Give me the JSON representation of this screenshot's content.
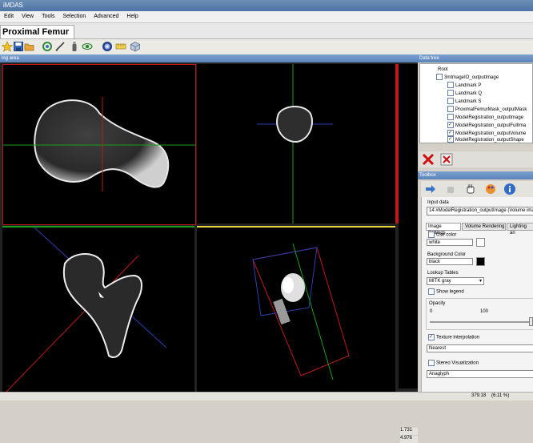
{
  "window": {
    "title": "iMDAS"
  },
  "menu": [
    "Edit",
    "View",
    "Tools",
    "Selection",
    "Advanced",
    "Help"
  ],
  "project_tab": "Proximal Femur",
  "toolbar_icons": [
    "star-icon",
    "save-icon",
    "open-folder-icon",
    "recycle-icon",
    "pen-icon",
    "bottle-icon",
    "eye-icon",
    "target-icon",
    "ruler-icon",
    "cube-icon"
  ],
  "viewer": {
    "title": "ing area",
    "scale_labels": [
      "1.731",
      "4.976"
    ]
  },
  "data_tree": {
    "title": "Data tree",
    "root": "Root",
    "items": [
      {
        "label": "3mImageIO_outputImage",
        "checked": false
      },
      {
        "label": "Landmark P",
        "checked": false
      },
      {
        "label": "Landmark Q",
        "checked": false
      },
      {
        "label": "Landmark S",
        "checked": false
      },
      {
        "label": "ProximalFemurMask_outputMask",
        "checked": false
      },
      {
        "label": "ModelRegistration_outputImage",
        "checked": false
      },
      {
        "label": "ModelRegistration_outputFullIma",
        "checked": true
      },
      {
        "label": "ModelRegistration_outputVolume",
        "checked": true
      },
      {
        "label": "ModelRegistration_outputShape",
        "checked": true
      }
    ]
  },
  "toolbox": {
    "title": "Toolbox",
    "input_data_label": "Input data",
    "input_data_value": "14:#ModelRegistration_outputImage (Volume ima",
    "tabs": [
      "Image Settings",
      "Volume Rendering",
      "Lighting an"
    ],
    "use_color_label": "Use color",
    "color_value": "white",
    "background_label": "Background Color",
    "background_value": "black",
    "lookup_label": "Lookup Tables",
    "lookup_value": "MITK gray",
    "show_legend_label": "Show legend",
    "opacity_label": "Opacity",
    "opacity_min": "0",
    "opacity_max": "100",
    "opacity_value": 100,
    "texture_label": "Texture interpolation",
    "texture_checked": true,
    "interp_value": "Nearest",
    "stereo_label": "Stereo Visualization",
    "stereo_value": "Anaglyph"
  },
  "status": {
    "coords": "379.18",
    "zoom": "(6.11 %)"
  }
}
